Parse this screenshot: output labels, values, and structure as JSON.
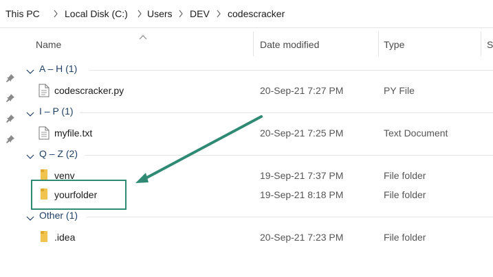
{
  "breadcrumb": [
    "This PC",
    "Local Disk (C:)",
    "Users",
    "DEV",
    "codescracker"
  ],
  "columns": {
    "name": "Name",
    "date_modified": "Date modified",
    "type": "Type",
    "size_partial": "S"
  },
  "groups": [
    {
      "label": "A – H (1)",
      "files": [
        {
          "name": "codescracker.py",
          "date": "20-Sep-21 7:27 PM",
          "type": "PY File",
          "icon": "python-file-icon"
        }
      ]
    },
    {
      "label": "I – P (1)",
      "files": [
        {
          "name": "myfile.txt",
          "date": "20-Sep-21 7:25 PM",
          "type": "Text Document",
          "icon": "text-file-icon"
        }
      ]
    },
    {
      "label": "Q – Z (2)",
      "files": [
        {
          "name": "venv",
          "date": "19-Sep-21 7:37 PM",
          "type": "File folder",
          "icon": "folder-icon"
        },
        {
          "name": "yourfolder",
          "date": "19-Sep-21 8:18 PM",
          "type": "File folder",
          "icon": "folder-icon"
        }
      ]
    },
    {
      "label": "Other (1)",
      "files": [
        {
          "name": ".idea",
          "date": "20-Sep-21 7:23 PM",
          "type": "File folder",
          "icon": "folder-icon"
        }
      ]
    }
  ],
  "colors": {
    "accent": "#2e8a73",
    "group_text": "#1f3f68",
    "folder": "#f0c24e"
  }
}
